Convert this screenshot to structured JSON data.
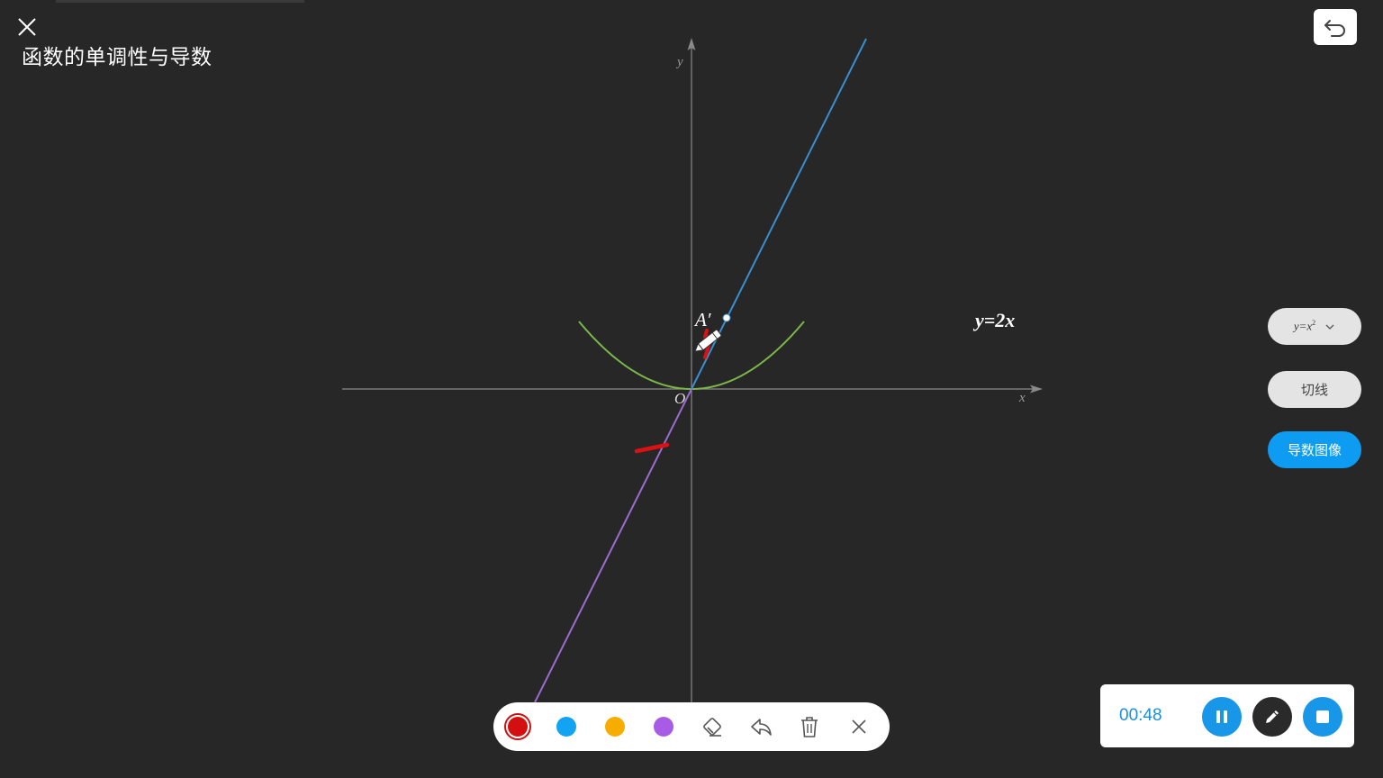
{
  "header": {
    "title": "函数的单调性与导数",
    "close_icon": "close-icon",
    "undo_icon": "undo-icon"
  },
  "graph": {
    "y_axis_label": "y",
    "x_axis_label": "x",
    "origin_label": "O",
    "point_label": "A′",
    "line_label": "y=2x",
    "colors": {
      "parabola": "#7ab648",
      "line_upper": "#3a8fd0",
      "line_lower": "#9a6bd0",
      "axes": "#8a8a8a",
      "ink": "#dd1111"
    }
  },
  "side_panel": {
    "function_select": {
      "y": "y",
      "eq": "=",
      "x": "x",
      "exp": "2"
    },
    "tangent_label": "切线",
    "derivative_label": "导数图像"
  },
  "toolbar": {
    "colors": [
      "#d40f0f",
      "#12a4f2",
      "#f6ad00",
      "#a85ce6"
    ],
    "selected_color": "#d40f0f",
    "icons": [
      "eraser-icon",
      "undo-arrow-icon",
      "trash-icon",
      "close-icon"
    ]
  },
  "recorder": {
    "time": "00:48",
    "pause_color": "#1896e8",
    "pen_color": "#2a2a2a",
    "stop_color": "#1896e8"
  }
}
